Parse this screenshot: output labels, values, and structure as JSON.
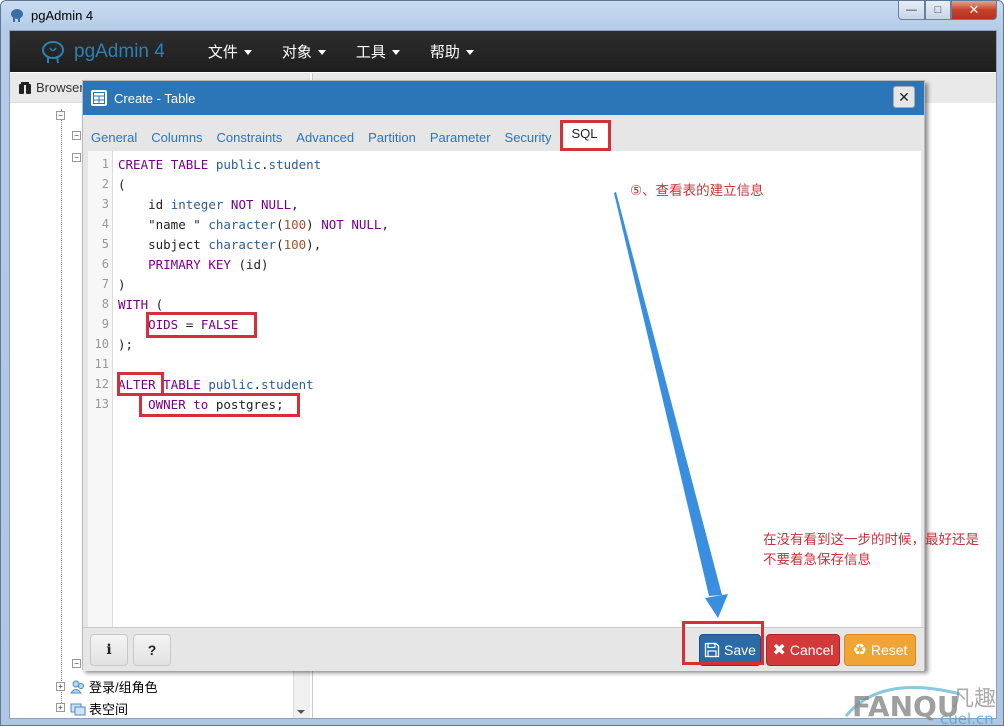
{
  "window": {
    "title": "pgAdmin 4",
    "controls": {
      "minimize": "—",
      "maximize": "□",
      "close": "✕"
    }
  },
  "navbar": {
    "brand": "pgAdmin 4",
    "menus": [
      {
        "label": "文件"
      },
      {
        "label": "对象"
      },
      {
        "label": "工具"
      },
      {
        "label": "帮助"
      }
    ]
  },
  "browser": {
    "tab_label": "Browser",
    "tree_items": [
      {
        "label": "登录/组角色",
        "icon": "login-roles-icon"
      },
      {
        "label": "表空间",
        "icon": "tablespace-icon"
      }
    ]
  },
  "dialog": {
    "title": "Create - Table",
    "close_label": "✕",
    "tabs": [
      {
        "label": "General",
        "active": false
      },
      {
        "label": "Columns",
        "active": false
      },
      {
        "label": "Constraints",
        "active": false
      },
      {
        "label": "Advanced",
        "active": false
      },
      {
        "label": "Partition",
        "active": false
      },
      {
        "label": "Parameter",
        "active": false
      },
      {
        "label": "Security",
        "active": false
      },
      {
        "label": "SQL",
        "active": true
      }
    ],
    "sql_lines": [
      {
        "n": "1",
        "text": "CREATE TABLE public.student"
      },
      {
        "n": "2",
        "text": "("
      },
      {
        "n": "3",
        "text": "    id integer NOT NULL,"
      },
      {
        "n": "4",
        "text": "    \"name \" character(100) NOT NULL,"
      },
      {
        "n": "5",
        "text": "    subject character(100),"
      },
      {
        "n": "6",
        "text": "    PRIMARY KEY (id)"
      },
      {
        "n": "7",
        "text": ")"
      },
      {
        "n": "8",
        "text": "WITH ("
      },
      {
        "n": "9",
        "text": "    OIDS = FALSE"
      },
      {
        "n": "10",
        "text": ");"
      },
      {
        "n": "11",
        "text": ""
      },
      {
        "n": "12",
        "text": "ALTER TABLE public.student"
      },
      {
        "n": "13",
        "text": "    OWNER to postgres;"
      }
    ],
    "footer": {
      "info_label": "i",
      "help_label": "?",
      "save_label": "Save",
      "cancel_label": "Cancel",
      "reset_label": "Reset"
    }
  },
  "annotations": {
    "step_note": "⑤、查看表的建立信息",
    "warning_line1": "在没有看到这一步的时候，最好还是",
    "warning_line2": "不要着急保存信息"
  },
  "colors": {
    "dialog_header": "#2c76b8",
    "annotation_red": "#d5303a",
    "arrow_blue": "#3a8ee0",
    "save": "#2a6aa6",
    "cancel": "#d23a3a",
    "reset": "#f0a436"
  },
  "watermark": {
    "text1": "FANQU",
    "text2": "cuel.cn",
    "text3": "凡趣"
  }
}
